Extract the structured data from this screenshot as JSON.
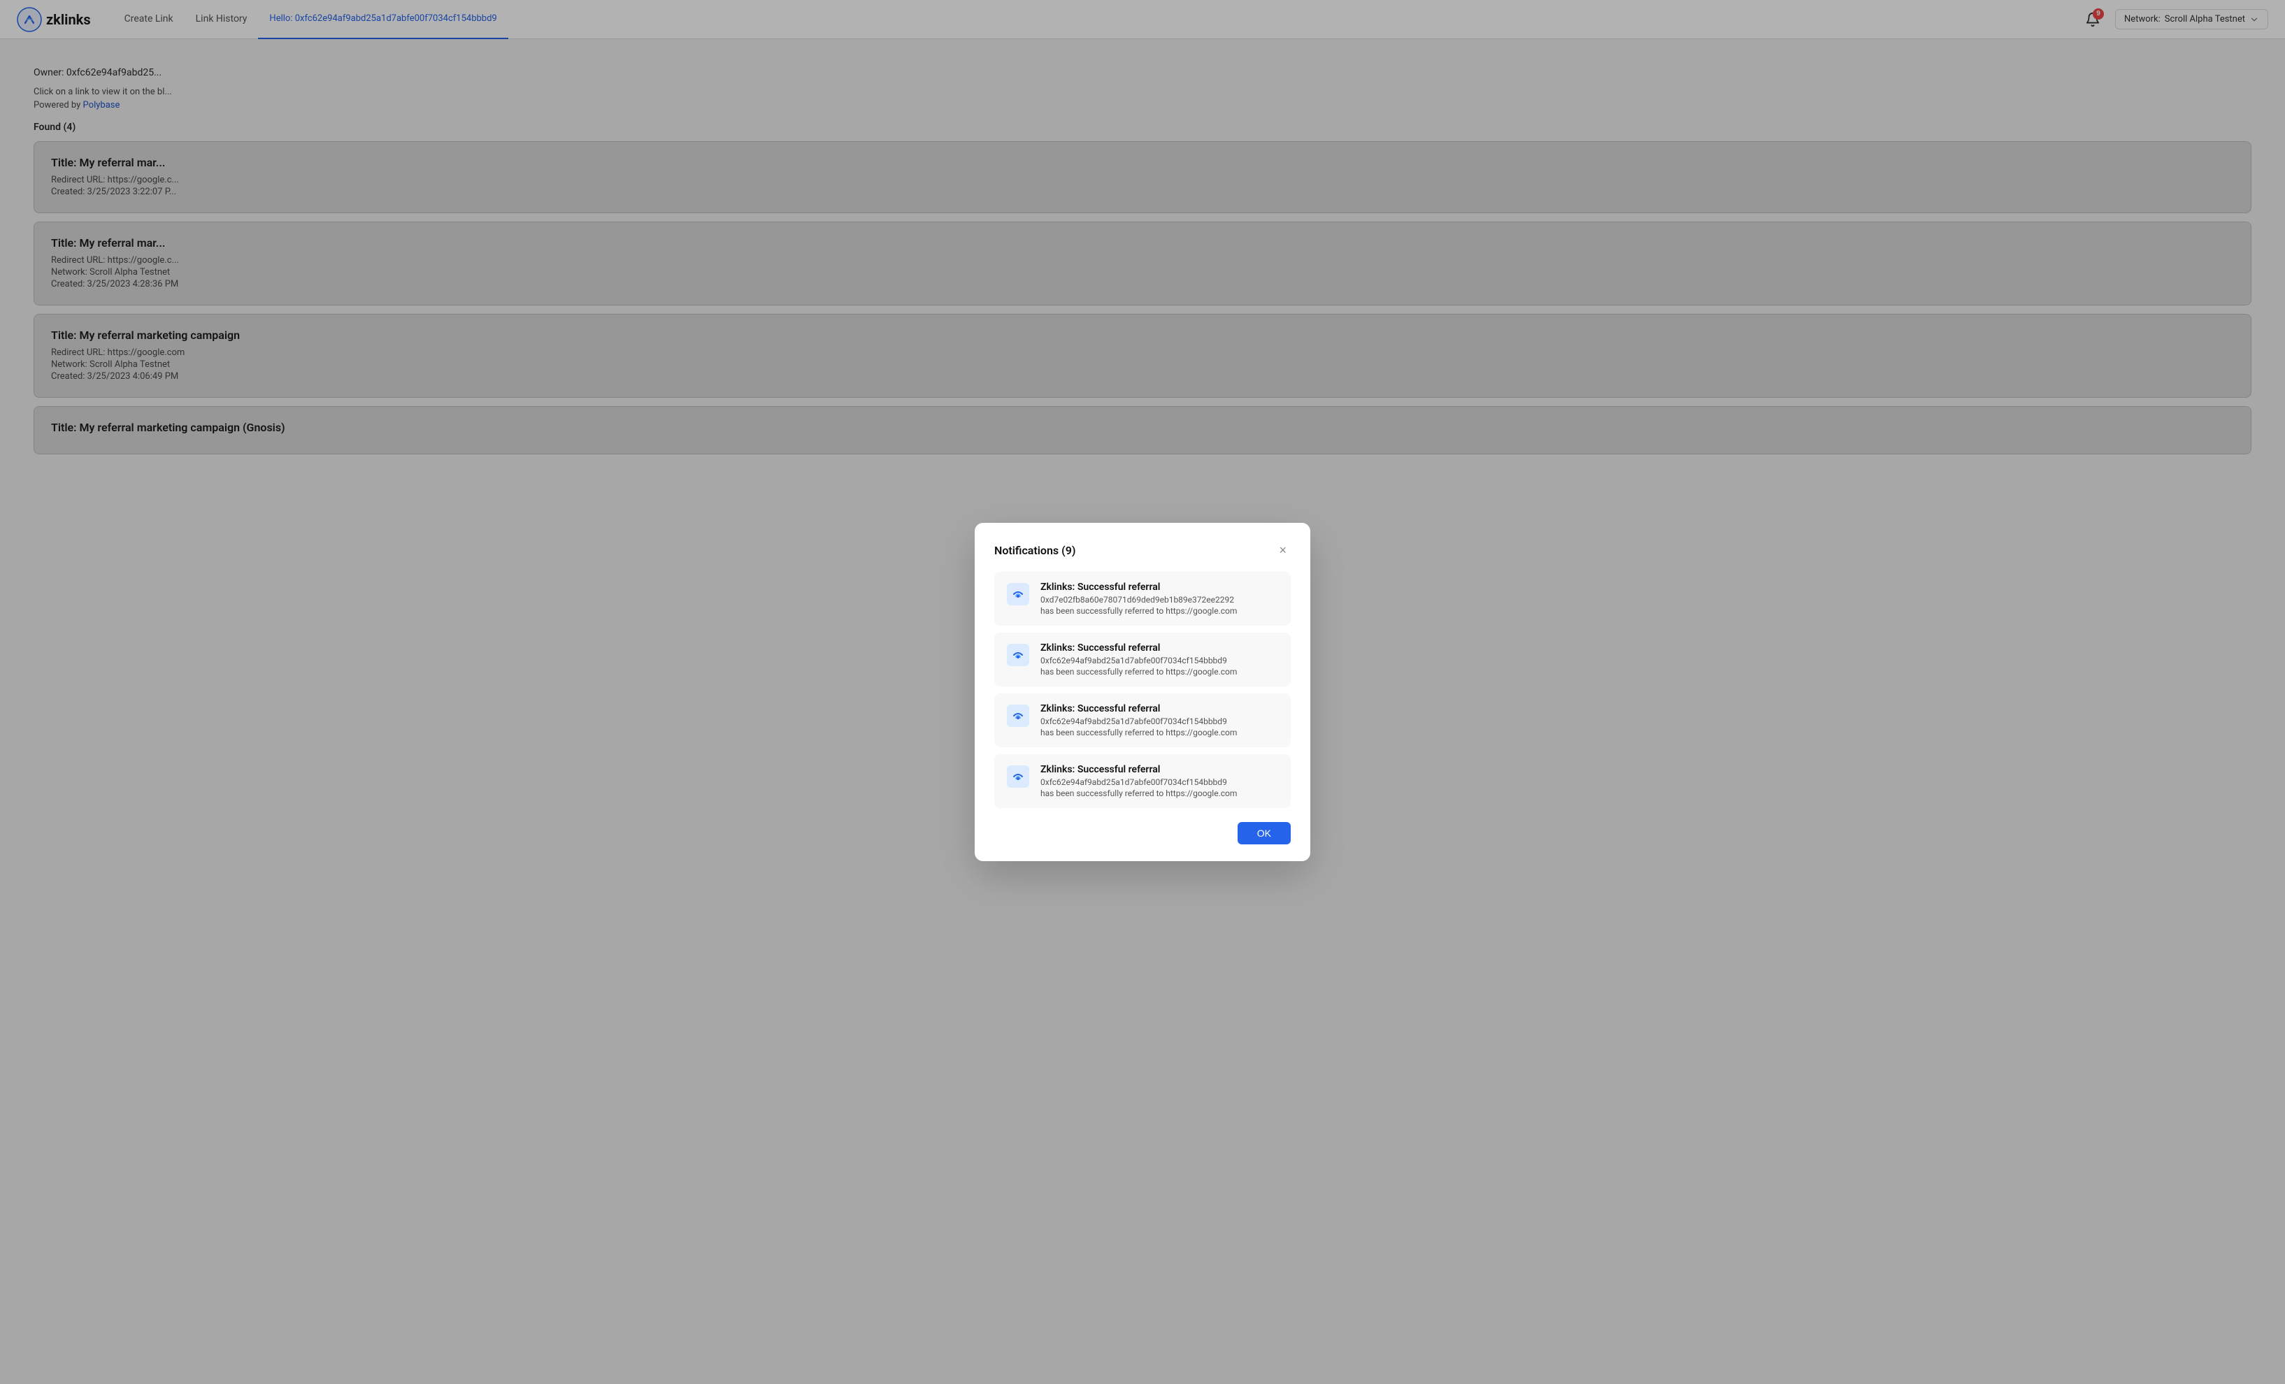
{
  "navbar": {
    "logo_text": "zklinks",
    "nav_items": [
      {
        "label": "Create Link",
        "active": false
      },
      {
        "label": "Link History",
        "active": false
      },
      {
        "label": "Hello: 0xfc62e94af9abd25a1d7abfe00f7034cf154bbbd9",
        "active": true
      }
    ],
    "notification_count": "9",
    "network_label": "Network:",
    "network_name": "Scroll Alpha Testnet"
  },
  "main": {
    "owner": "Owner: 0xfc62e94af9abd25...",
    "click_info": "Click on a link to view it on the bl...",
    "powered_by": "Powered by",
    "polybase_label": "Polybase",
    "found_label": "Found (4)",
    "cards": [
      {
        "title": "Title: My referral mar...",
        "redirect": "Redirect URL: https://google.c...",
        "created": "Created: 3/25/2023 3:22:07 P..."
      },
      {
        "title": "Title: My referral mar...",
        "redirect": "Redirect URL: https://google.c...",
        "network": "Network: Scroll Alpha Testnet",
        "created": "Created: 3/25/2023 4:28:36 PM"
      },
      {
        "title": "Title: My referral marketing campaign",
        "redirect": "Redirect URL: https://google.com",
        "network": "Network: Scroll Alpha Testnet",
        "created": "Created: 3/25/2023 4:06:49 PM"
      },
      {
        "title": "Title: My referral marketing campaign (Gnosis)",
        "redirect": "",
        "network": "",
        "created": ""
      }
    ]
  },
  "modal": {
    "title": "Notifications (9)",
    "close_label": "×",
    "notifications": [
      {
        "heading": "Zklinks: Successful referral",
        "address": "0xd7e02fb8a60e78071d69ded9eb1b89e372ee2292",
        "desc": "has been successfully referred to https://google.com"
      },
      {
        "heading": "Zklinks: Successful referral",
        "address": "0xfc62e94af9abd25a1d7abfe00f7034cf154bbbd9",
        "desc": "has been successfully referred to https://google.com"
      },
      {
        "heading": "Zklinks: Successful referral",
        "address": "0xfc62e94af9abd25a1d7abfe00f7034cf154bbbd9",
        "desc": "has been successfully referred to https://google.com"
      },
      {
        "heading": "Zklinks: Successful referral",
        "address": "0xfc62e94af9abd25a1d7abfe00f7034cf154bbbd9",
        "desc": "has been successfully referred to https://google.com"
      }
    ],
    "ok_label": "OK"
  }
}
